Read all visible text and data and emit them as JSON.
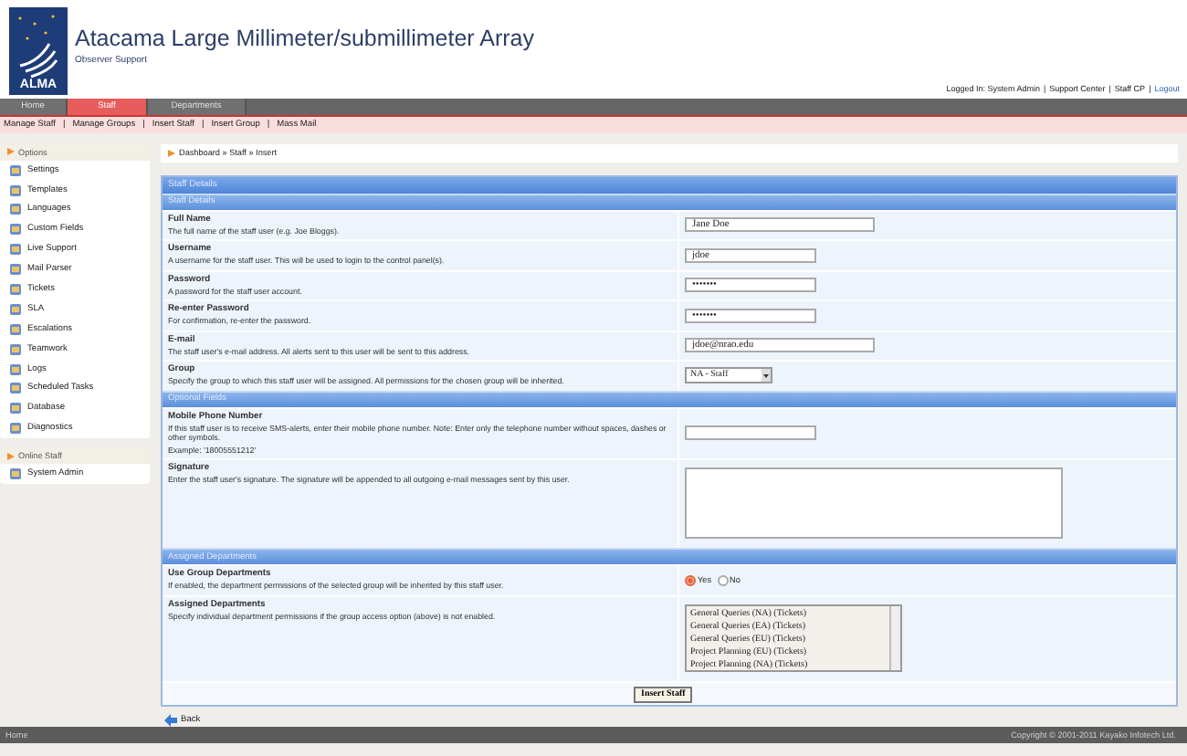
{
  "header": {
    "logo_text": "ALMA",
    "title": "Atacama Large Millimeter/submillimeter Array",
    "subtitle": "Observer Support"
  },
  "login_bar": {
    "label": "Logged In: System Admin",
    "separator": "|",
    "links": [
      "Support Center",
      "Staff CP",
      "Logout"
    ]
  },
  "tabs": [
    {
      "label": "Home",
      "selected": false
    },
    {
      "label": "Staff",
      "selected": true
    },
    {
      "label": "Departments",
      "selected": false
    }
  ],
  "submenu": {
    "separator": "|",
    "links": [
      "Manage Staff",
      "Manage Groups",
      "Insert Staff",
      "Insert Group",
      "Mass Mail"
    ]
  },
  "sidebar": [
    {
      "title": "Options",
      "items": [
        "Settings",
        "Templates",
        "Languages",
        "Custom Fields",
        "Live Support",
        "Mail Parser",
        "Tickets",
        "SLA",
        "Escalations",
        "Teamwork",
        "Logs",
        "Scheduled Tasks",
        "Database",
        "Diagnostics"
      ]
    },
    {
      "title": "Online Staff",
      "items": [
        "System Admin"
      ]
    }
  ],
  "breadcrumb": "Dashboard » Staff » Insert",
  "panel_title": "Staff Details",
  "sections": [
    {
      "title": "Staff Details",
      "rows": [
        {
          "kind": "longtext",
          "label": "Full Name",
          "help": "The full name of the staff user (e.g. Joe Bloggs).",
          "value": "Jane Doe"
        },
        {
          "kind": "text",
          "label": "Username",
          "help": "A username for the staff user. This will be used to login to the control panel(s).",
          "value": "jdoe"
        },
        {
          "kind": "text",
          "label": "Password",
          "help": "A password for the staff user account.",
          "value": "•••••••"
        },
        {
          "kind": "text",
          "label": "Re-enter Password",
          "help": "For confirmation, re-enter the password.",
          "value": "•••••••"
        },
        {
          "kind": "longtext",
          "label": "E-mail",
          "help": "The staff user's e-mail address. All alerts sent to this user will be sent to this address.",
          "value": "jdoe@nrao.edu"
        },
        {
          "kind": "select",
          "label": "Group",
          "help": "Specify the group to which this staff user will be assigned. All permissions for the chosen group will be inherited.",
          "value": "NA - Staff"
        }
      ]
    },
    {
      "title": "Optional Fields",
      "rows": [
        {
          "kind": "mobile",
          "label": "Mobile Phone Number",
          "help": "If this staff user is to receive SMS-alerts, enter their mobile phone number. Note: Enter only the telephone number without spaces, dashes or other symbols.",
          "example": "Example: '18005551212'"
        },
        {
          "kind": "textarea",
          "label": "Signature",
          "help": "Enter the staff user's signature. The signature will be appended to all outgoing e-mail messages sent by this user."
        }
      ]
    },
    {
      "title": "Assigned Departments",
      "rows": [
        {
          "kind": "radio",
          "label": "Use Group Departments",
          "help": "If enabled, the department permissions of the selected group will be inherited by this staff user.",
          "options": [
            {
              "label": "Yes",
              "selected": true
            },
            {
              "label": "No",
              "selected": false
            }
          ]
        },
        {
          "kind": "listbox",
          "label": "Assigned Departments",
          "help": "Specify individual department permissions if the group access option (above) is not enabled.",
          "options": [
            "General Queries (NA) (Tickets)",
            "General Queries (EA) (Tickets)",
            "General Queries (EU) (Tickets)",
            "Project Planning (EU) (Tickets)",
            "Project Planning (NA) (Tickets)"
          ]
        }
      ]
    }
  ],
  "submit": "Insert Staff",
  "back": "Back",
  "footer": {
    "left": "Home",
    "right": "Copyright © 2001-2011 Kayako Infotech Ltd."
  }
}
